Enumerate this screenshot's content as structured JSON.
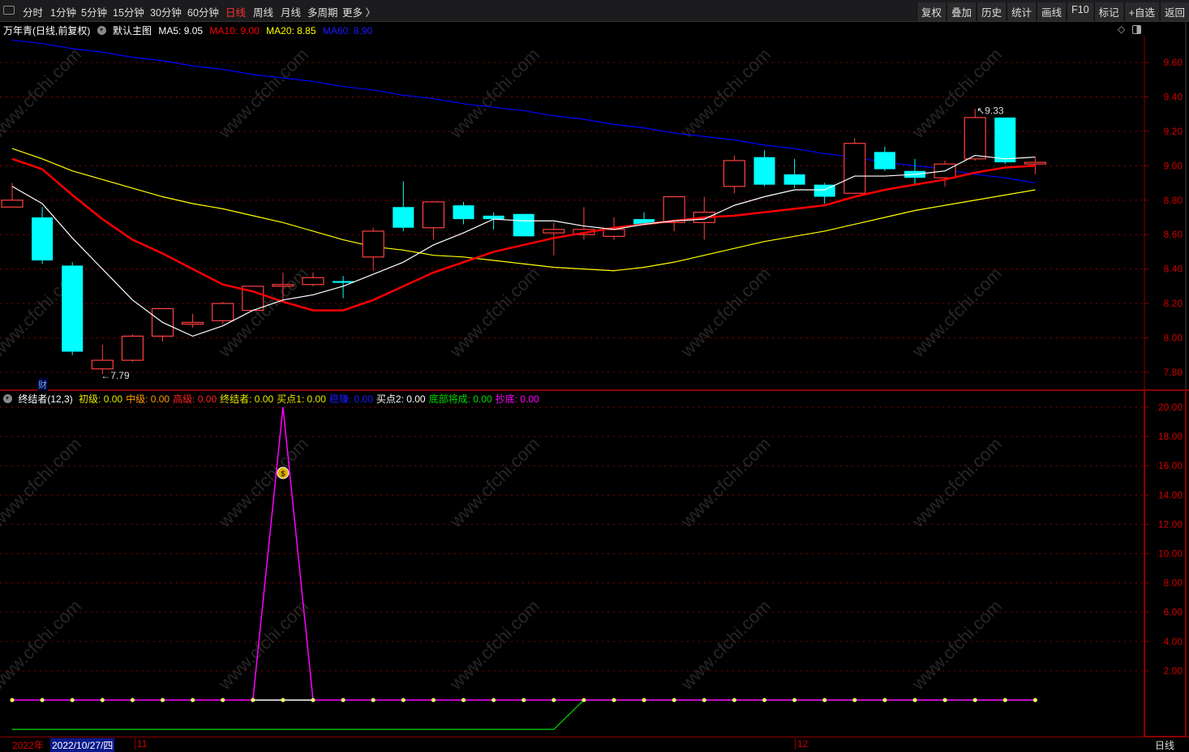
{
  "toolbar": {
    "periods": [
      "分时",
      "1分钟",
      "5分钟",
      "15分钟",
      "30分钟",
      "60分钟",
      "日线",
      "周线",
      "月线",
      "多周期",
      "更多 〉"
    ],
    "active": "日线",
    "buttons": [
      "复权",
      "叠加",
      "历史",
      "统计",
      "画线",
      "F10",
      "标记",
      "+自选",
      "返回"
    ]
  },
  "info": {
    "title": "万年青(日线,前复权)",
    "main": "默认主图",
    "ma5": "MA5: 9.05",
    "ma10": "MA10: 9.00",
    "ma20": "MA20: 8.85",
    "ma60": "MA60: 8.90"
  },
  "indicator": {
    "name": "终结者(12,3)",
    "items": [
      {
        "t": "初级: 0.00",
        "c": "#e6e600"
      },
      {
        "t": "中级: 0.00",
        "c": "#ff9900"
      },
      {
        "t": "高级: 0.00",
        "c": "#ff2020"
      },
      {
        "t": "终结者: 0.00",
        "c": "#e6e600"
      },
      {
        "t": "买点1: 0.00",
        "c": "#e6e600"
      },
      {
        "t": "稳赚: 0.00",
        "c": "#1a1aff"
      },
      {
        "t": "买点2: 0.00",
        "c": "#ffffff"
      },
      {
        "t": "底部将成: 0.00",
        "c": "#00dd00"
      },
      {
        "t": "抄底: 0.00",
        "c": "#ff00ff"
      }
    ]
  },
  "colors": {
    "up": "#ff4040",
    "down": "#00ffff",
    "ma5": "#ffffff",
    "ma10": "#ff0000",
    "ma20": "#ffff00",
    "ma60": "#0000ff",
    "grid": "#8b0000",
    "axis": "#cc0000"
  },
  "chart_data": {
    "type": "candlestick",
    "price_axis": [
      "9.60",
      "9.40",
      "9.20",
      "9.00",
      "8.80",
      "8.60",
      "8.40",
      "8.20",
      "8.00",
      "7.80"
    ],
    "ind_axis": [
      "20.00",
      "18.00",
      "16.00",
      "14.00",
      "12.00",
      "10.00",
      "8.00",
      "6.00",
      "4.00",
      "2.00"
    ],
    "ohlc": [
      [
        8.76,
        8.9,
        8.76,
        8.8
      ],
      [
        8.7,
        8.76,
        8.43,
        8.45
      ],
      [
        8.42,
        8.44,
        7.9,
        7.92
      ],
      [
        7.82,
        7.96,
        7.79,
        7.87
      ],
      [
        7.87,
        8.02,
        7.86,
        8.01
      ],
      [
        8.01,
        8.17,
        7.98,
        8.17
      ],
      [
        8.08,
        8.14,
        8.06,
        8.09
      ],
      [
        8.1,
        8.21,
        8.08,
        8.2
      ],
      [
        8.16,
        8.3,
        8.16,
        8.3
      ],
      [
        8.3,
        8.38,
        8.22,
        8.31
      ],
      [
        8.31,
        8.38,
        8.3,
        8.35
      ],
      [
        8.33,
        8.36,
        8.23,
        8.32
      ],
      [
        8.47,
        8.64,
        8.39,
        8.62
      ],
      [
        8.76,
        8.91,
        8.62,
        8.64
      ],
      [
        8.64,
        8.79,
        8.57,
        8.79
      ],
      [
        8.77,
        8.79,
        8.66,
        8.69
      ],
      [
        8.71,
        8.73,
        8.63,
        8.69
      ],
      [
        8.72,
        8.72,
        8.59,
        8.59
      ],
      [
        8.61,
        8.67,
        8.48,
        8.63
      ],
      [
        8.6,
        8.76,
        8.57,
        8.63
      ],
      [
        8.59,
        8.7,
        8.57,
        8.63
      ],
      [
        8.69,
        8.73,
        8.66,
        8.66
      ],
      [
        8.67,
        8.82,
        8.62,
        8.82
      ],
      [
        8.67,
        8.82,
        8.57,
        8.73
      ],
      [
        8.88,
        9.06,
        8.84,
        9.03
      ],
      [
        9.05,
        9.09,
        8.88,
        8.89
      ],
      [
        8.95,
        9.04,
        8.87,
        8.89
      ],
      [
        8.89,
        8.9,
        8.78,
        8.82
      ],
      [
        8.84,
        9.16,
        8.84,
        9.13
      ],
      [
        9.08,
        9.11,
        8.97,
        8.98
      ],
      [
        8.97,
        9.04,
        8.89,
        8.93
      ],
      [
        8.93,
        9.03,
        8.88,
        9.01
      ],
      [
        9.04,
        9.33,
        9.03,
        9.28
      ],
      [
        9.28,
        9.28,
        9.01,
        9.02
      ],
      [
        9.01,
        9.05,
        8.95,
        9.02
      ]
    ],
    "ma5": [
      8.88,
      8.78,
      8.58,
      8.4,
      8.22,
      8.09,
      8.01,
      8.07,
      8.16,
      8.22,
      8.25,
      8.3,
      8.37,
      8.44,
      8.54,
      8.61,
      8.69,
      8.68,
      8.68,
      8.65,
      8.63,
      8.66,
      8.68,
      8.69,
      8.77,
      8.82,
      8.86,
      8.86,
      8.94,
      8.94,
      8.95,
      8.97,
      9.06,
      9.04,
      9.05
    ],
    "ma10": [
      9.04,
      8.98,
      8.83,
      8.69,
      8.57,
      8.49,
      8.4,
      8.31,
      8.27,
      8.21,
      8.16,
      8.16,
      8.22,
      8.3,
      8.38,
      8.44,
      8.5,
      8.54,
      8.58,
      8.61,
      8.64,
      8.66,
      8.68,
      8.7,
      8.71,
      8.73,
      8.75,
      8.77,
      8.82,
      8.86,
      8.89,
      8.92,
      8.96,
      8.99,
      9.0
    ],
    "ma20": [
      9.1,
      9.04,
      8.97,
      8.92,
      8.87,
      8.82,
      8.78,
      8.75,
      8.71,
      8.67,
      8.62,
      8.57,
      8.53,
      8.51,
      8.48,
      8.47,
      8.45,
      8.43,
      8.41,
      8.4,
      8.39,
      8.41,
      8.44,
      8.48,
      8.52,
      8.56,
      8.59,
      8.62,
      8.66,
      8.7,
      8.74,
      8.77,
      8.8,
      8.83,
      8.86
    ],
    "ma60": [
      9.73,
      9.71,
      9.68,
      9.66,
      9.63,
      9.61,
      9.58,
      9.56,
      9.53,
      9.51,
      9.49,
      9.46,
      9.44,
      9.41,
      9.39,
      9.36,
      9.34,
      9.32,
      9.29,
      9.27,
      9.24,
      9.22,
      9.19,
      9.17,
      9.15,
      9.12,
      9.1,
      9.07,
      9.05,
      9.02,
      9.0,
      8.98,
      8.95,
      8.93,
      8.9
    ],
    "high_label": "9.33",
    "low_label": "7.79",
    "ind_main": [
      0,
      0,
      0,
      0,
      0,
      0,
      0,
      0,
      0,
      20,
      0,
      0,
      0,
      0,
      0,
      0,
      0,
      0,
      0,
      0,
      0,
      0,
      0,
      0,
      0,
      0,
      0,
      0,
      0,
      0,
      0,
      0,
      0,
      0,
      0
    ],
    "ind_green": [
      -2,
      -2,
      -2,
      -2,
      -2,
      -2,
      -2,
      -2,
      -2,
      -2,
      -2,
      -2,
      -2,
      -2,
      -2,
      -2,
      -2,
      -2,
      -2,
      0,
      0,
      0,
      0,
      0,
      0,
      0,
      0,
      0,
      0,
      0,
      0,
      0,
      0,
      0,
      0
    ],
    "signal_index": 9
  },
  "marker": "财",
  "bottom": {
    "year": "2022年",
    "cursor_date": "2022/10/27/四",
    "m11": "11",
    "m12": "12",
    "period": "日线"
  },
  "watermark": "www.cfchi.com"
}
